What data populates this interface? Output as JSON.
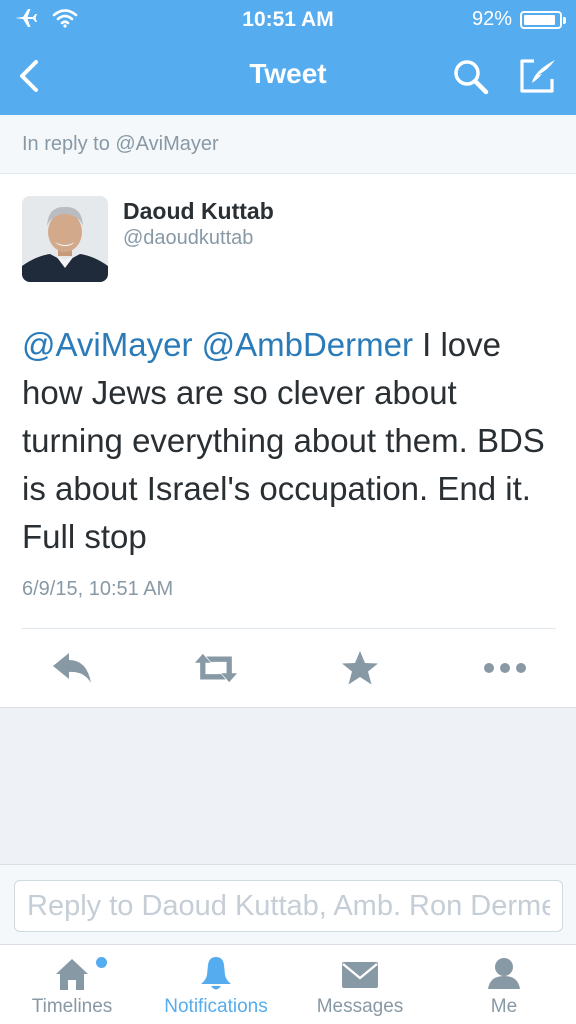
{
  "status_bar": {
    "time": "10:51 AM",
    "battery_text": "92%",
    "battery_level": 0.92
  },
  "nav": {
    "title": "Tweet"
  },
  "reply_context": {
    "text": "In reply to @AviMayer"
  },
  "tweet": {
    "author_name": "Daoud Kuttab",
    "author_handle": "@daoudkuttab",
    "mention_1": "@AviMayer",
    "mention_2": "@AmbDermer",
    "body": " I love how Jews are so clever about turning everything about them. BDS is about Israel's occupation. End it. Full stop",
    "timestamp": "6/9/15, 10:51 AM"
  },
  "reply_bar": {
    "placeholder": "Reply to Daoud Kuttab, Amb. Ron Dermer"
  },
  "tabs": [
    {
      "label": "Timelines",
      "icon": "home-icon"
    },
    {
      "label": "Notifications",
      "icon": "bell-icon"
    },
    {
      "label": "Messages",
      "icon": "envelope-icon"
    },
    {
      "label": "Me",
      "icon": "person-icon"
    }
  ],
  "colors": {
    "brand": "#55acee",
    "link": "#2b7bb9",
    "text": "#292f33",
    "muted": "#8899a6",
    "icon": "#8899a6"
  }
}
